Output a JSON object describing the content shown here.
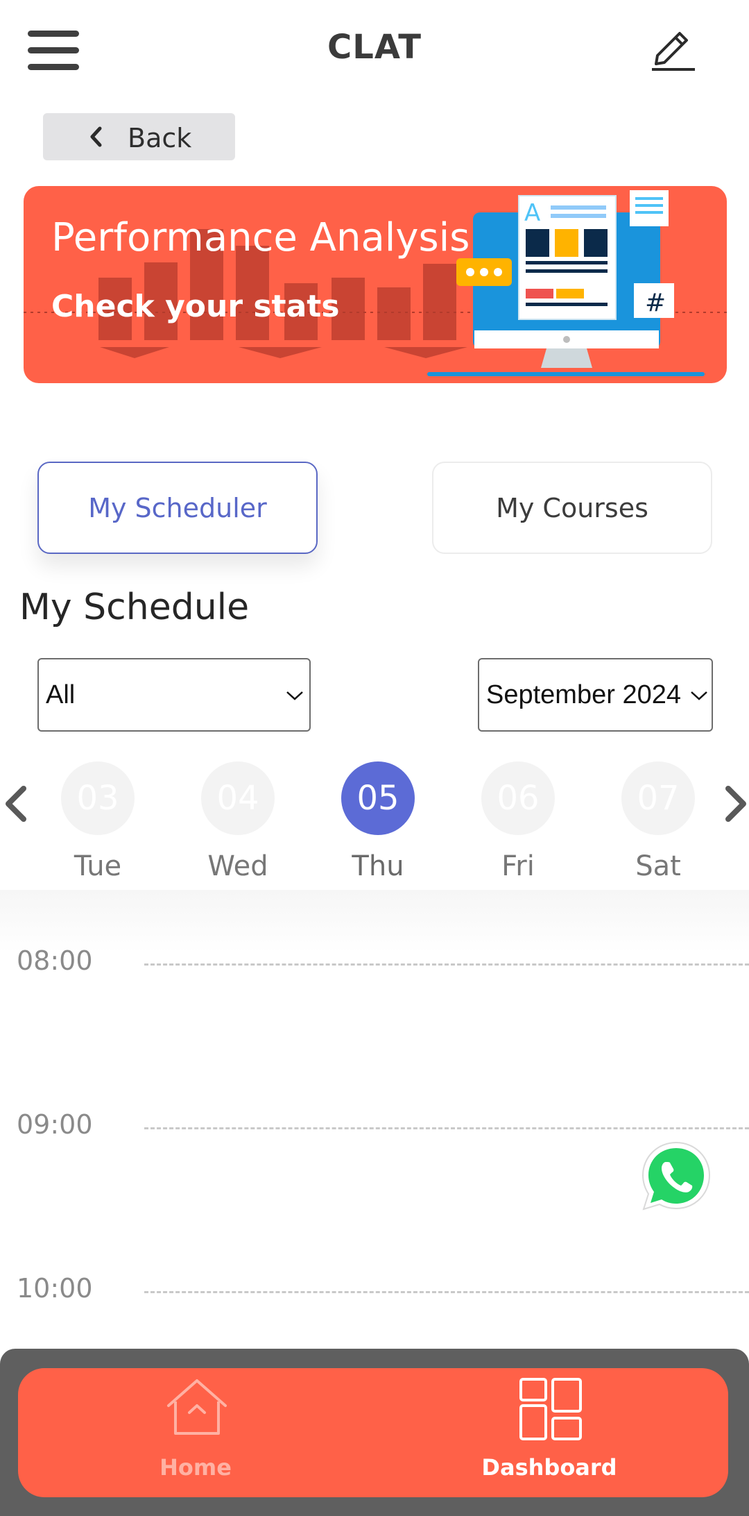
{
  "header": {
    "title": "CLAT"
  },
  "back": {
    "label": "Back"
  },
  "banner": {
    "title": "Performance Analysis",
    "subtitle": "Check your stats",
    "bg_color": "#ff6148"
  },
  "tabs": [
    {
      "label": "My Scheduler",
      "active": true
    },
    {
      "label": "My Courses",
      "active": false
    }
  ],
  "schedule": {
    "title": "My Schedule",
    "filter_value": "All",
    "month_value": "September 2024"
  },
  "days": [
    {
      "num": "03",
      "name": "Tue"
    },
    {
      "num": "04",
      "name": "Wed"
    },
    {
      "num": "05",
      "name": "Thu",
      "selected": true
    },
    {
      "num": "06",
      "name": "Fri"
    },
    {
      "num": "07",
      "name": "Sat"
    }
  ],
  "timeline": [
    "08:00",
    "09:00",
    "10:00"
  ],
  "bottom_nav": {
    "home_label": "Home",
    "dashboard_label": "Dashboard",
    "active": "Dashboard"
  },
  "colors": {
    "accent": "#5c6bd6",
    "brand": "#ff6148",
    "nav_frame": "#5f5f5f",
    "whatsapp": "#25d366"
  },
  "icons": [
    "hamburger-menu-icon",
    "edit-pencil-icon",
    "chevron-left-icon",
    "chevron-right-icon",
    "chevron-down-icon",
    "whatsapp-icon",
    "home-icon",
    "dashboard-grid-icon"
  ]
}
